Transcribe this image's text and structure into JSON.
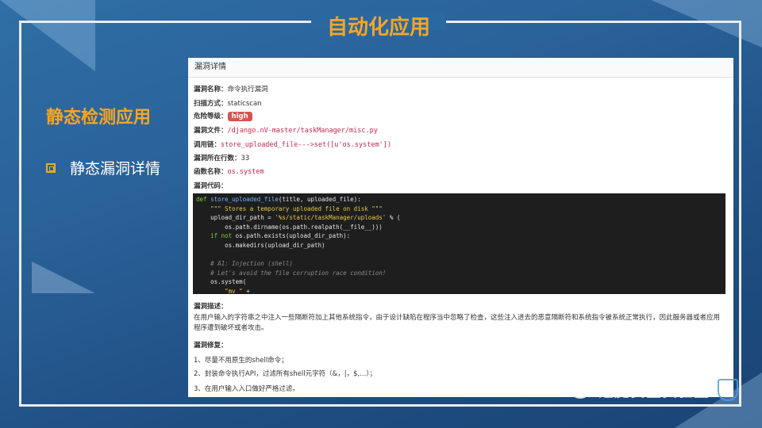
{
  "slide": {
    "title": "自动化应用",
    "side_title": "静态检测应用",
    "bullet": "静态漏洞详情"
  },
  "panel": {
    "header": "漏洞详情",
    "fields": {
      "name_label": "漏洞名称：",
      "name_value": "命令执行漏洞",
      "scan_label": "扫描方式：",
      "scan_value": "staticscan",
      "level_label": "危险等级：",
      "level_value": "high",
      "file_label": "漏洞文件：",
      "file_value": "/django.nV-master/taskManager/misc.py",
      "chain_label": "调用链：",
      "chain_value": "store_uploaded_file--->set([u'os.system'])",
      "line_label": "漏洞所在行数：",
      "line_value": "33",
      "func_label": "函数名称：",
      "func_value": "os.system",
      "code_label": "漏洞代码："
    },
    "code_lines": [
      {
        "kw": "def ",
        "fn": "store_uploaded_file",
        "rest": "(title, uploaded_file):"
      },
      {
        "indent": "    ",
        "str": "\"\"\" Stores a temporary uploaded file on disk \"\"\""
      },
      {
        "indent": "    ",
        "pre": "upload_dir_path = ",
        "str": "'%s/static/taskManager/uploads'",
        "rest": " % ("
      },
      {
        "indent": "        ",
        "pre": "os.path.dirname(os.path.realpath(__file__)))"
      },
      {
        "indent": "    ",
        "kw": "if not ",
        "pre": "os.path.exists(upload_dir_path):"
      },
      {
        "indent": "        ",
        "pre": "os.makedirs(upload_dir_path)"
      },
      {
        "indent": "",
        "pre": ""
      },
      {
        "indent": "    ",
        "cm": "# A1: Injection (shell)"
      },
      {
        "indent": "    ",
        "cm": "# Let's avoid the file corruption race condition!"
      },
      {
        "indent": "    ",
        "pre": "os.system("
      },
      {
        "indent": "        ",
        "str": "\"mv \"",
        "rest": " +"
      }
    ],
    "desc_label": "漏洞描述：",
    "desc_text": "在用户输入的字符串之中注入一些隔断符加上其他系统指令，由于设计缺陷在程序当中忽略了检查，这些注入进去的恶意隔断符和系统指令被系统正常执行，因此服务器或者应用程序遭到破坏或者攻击。",
    "fix_label": "漏洞修复：",
    "fixes": [
      "1、尽量不用原生的shell命令；",
      "2、封装命令执行API，过滤所有shell元字符（&，|，$,...）；",
      "3、在用户输入入口做好严格过滤。"
    ]
  },
  "watermark": {
    "text": "逢魔安全实验室"
  },
  "colors": {
    "accent": "#f5a623",
    "danger": "#d9534f",
    "code_bg": "#1e1e1e"
  }
}
